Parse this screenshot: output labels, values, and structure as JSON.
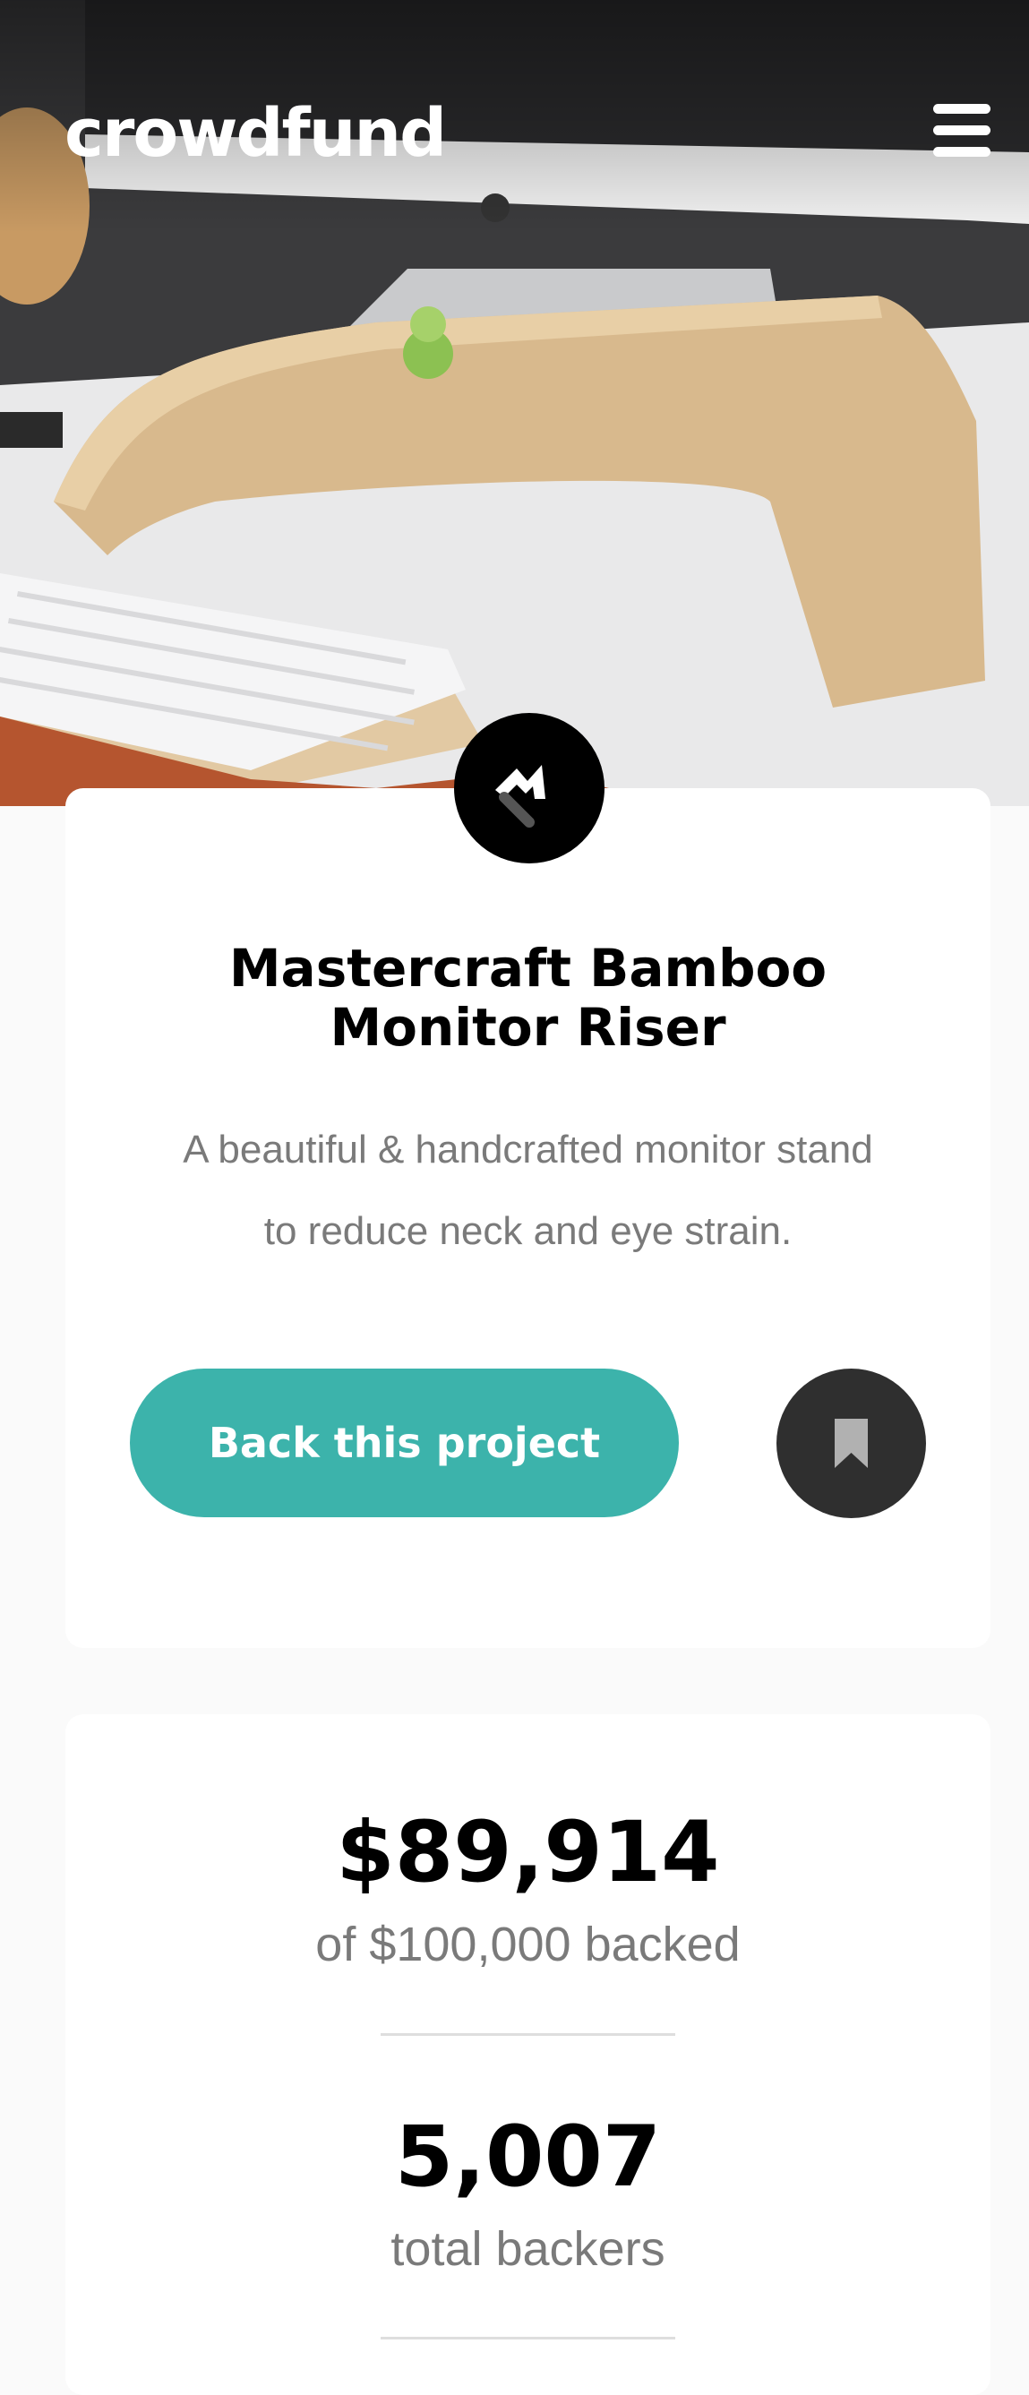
{
  "header": {
    "logo_text": "crowdfund",
    "menu_icon": "hamburger-icon"
  },
  "project": {
    "logo_icon": "mastercraft-logo-icon",
    "title_line1": "Mastercraft Bamboo",
    "title_line2": "Monitor Riser",
    "description_line1": "A beautiful & handcrafted monitor stand",
    "description_line2": "to reduce neck and eye strain.",
    "back_button_label": "Back this project",
    "bookmark_icon": "bookmark-icon"
  },
  "stats": {
    "amount_backed": "$89,914",
    "amount_label": "of $100,000 backed",
    "total_backers": "5,007",
    "backers_label": "total backers"
  },
  "colors": {
    "accent": "#3cb3ab",
    "dark": "#2f2f2f",
    "text_muted": "#7a7a7a",
    "page_bg": "#fafafa"
  }
}
